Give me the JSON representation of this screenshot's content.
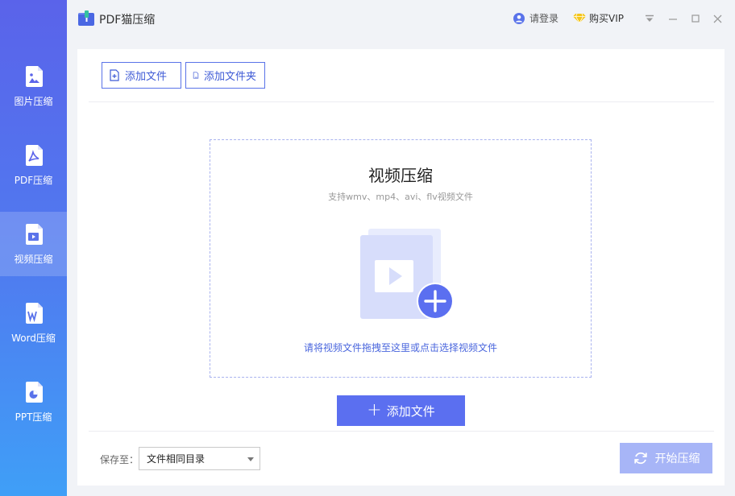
{
  "app": {
    "title": "PDF猫压缩"
  },
  "header": {
    "login_label": "请登录",
    "vip_label": "购买VIP"
  },
  "sidebar": {
    "items": [
      {
        "label": "图片压缩",
        "icon": "image-file-icon",
        "active": false
      },
      {
        "label": "PDF压缩",
        "icon": "pdf-file-icon",
        "active": false
      },
      {
        "label": "视频压缩",
        "icon": "video-file-icon",
        "active": true
      },
      {
        "label": "Word压缩",
        "icon": "word-file-icon",
        "active": false
      },
      {
        "label": "PPT压缩",
        "icon": "ppt-file-icon",
        "active": false
      }
    ]
  },
  "toolbar": {
    "add_file_label": "添加文件",
    "add_folder_label": "添加文件夹"
  },
  "dropzone": {
    "title": "视频压缩",
    "subtitle": "支持wmv、mp4、avi、flv视频文件",
    "hint": "请将视频文件拖拽至这里或点击选择视频文件"
  },
  "add_button": {
    "label": "添加文件"
  },
  "footer": {
    "save_label": "保存至：",
    "save_value": "文件相同目录",
    "start_label": "开始压缩"
  },
  "colors": {
    "accent": "#5b6ff0",
    "sidebar_top": "#5a63ea",
    "sidebar_bottom": "#3f9ff7",
    "start_disabled": "#a7b5f7",
    "vip_gold": "#f5c518"
  }
}
